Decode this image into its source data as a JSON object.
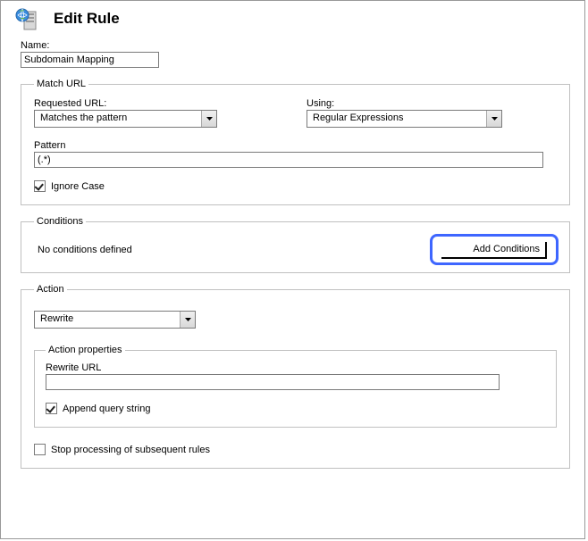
{
  "header": {
    "title": "Edit Rule"
  },
  "name": {
    "label": "Name:",
    "value": "Subdomain Mapping"
  },
  "matchUrl": {
    "legend": "Match URL",
    "requestedUrl": {
      "label": "Requested URL:",
      "selected": "Matches the pattern"
    },
    "using": {
      "label": "Using:",
      "selected": "Regular Expressions"
    },
    "pattern": {
      "label": "Pattern",
      "value": "(.*)"
    },
    "ignoreCase": {
      "label": "Ignore Case",
      "checked": true
    }
  },
  "conditions": {
    "legend": "Conditions",
    "emptyText": "No conditions defined",
    "addButton": "Add Conditions"
  },
  "action": {
    "legend": "Action",
    "type": {
      "selected": "Rewrite"
    },
    "properties": {
      "legend": "Action properties",
      "rewriteUrl": {
        "label": "Rewrite URL",
        "value": ""
      },
      "appendQuery": {
        "label": "Append query string",
        "checked": true
      }
    },
    "stopProcessing": {
      "label": "Stop processing of subsequent rules",
      "checked": false
    }
  }
}
